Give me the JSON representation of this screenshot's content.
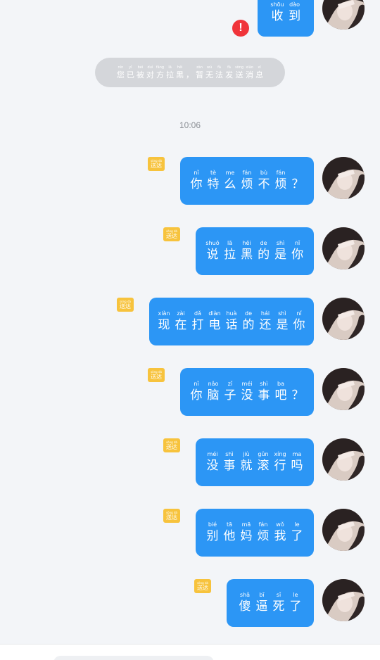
{
  "colors": {
    "bubble": "#2c96f5",
    "badge": "#f7c33d",
    "error": "#f0343a",
    "notice": "#d4d6da",
    "background": "#f3f5f8"
  },
  "icons": {
    "error": "exclamation-icon",
    "avatar": "avatar-photo"
  },
  "badge_label": {
    "pinyin": "sòng dá",
    "hanzi": "送达"
  },
  "top_message": {
    "chars": [
      {
        "py": "shōu",
        "hz": "收"
      },
      {
        "py": "dào",
        "hz": "到"
      }
    ],
    "error_mark": "!"
  },
  "notice": {
    "chars": [
      {
        "py": "nín",
        "hz": "您"
      },
      {
        "py": "yǐ",
        "hz": "已"
      },
      {
        "py": "bèi",
        "hz": "被"
      },
      {
        "py": "duì",
        "hz": "对"
      },
      {
        "py": "fāng",
        "hz": "方"
      },
      {
        "py": "lā",
        "hz": "拉"
      },
      {
        "py": "hēi",
        "hz": "黑"
      },
      {
        "py": "",
        "hz": "，"
      },
      {
        "py": "zàn",
        "hz": "暂"
      },
      {
        "py": "wú",
        "hz": "无"
      },
      {
        "py": "fǎ",
        "hz": "法"
      },
      {
        "py": "fā",
        "hz": "发"
      },
      {
        "py": "sòng",
        "hz": "送"
      },
      {
        "py": "xiāo",
        "hz": "消"
      },
      {
        "py": "xī",
        "hz": "息"
      }
    ]
  },
  "timestamp": "10:06",
  "messages": [
    {
      "chars": [
        {
          "py": "nǐ",
          "hz": "你"
        },
        {
          "py": "tè",
          "hz": "特"
        },
        {
          "py": "me",
          "hz": "么"
        },
        {
          "py": "fán",
          "hz": "烦"
        },
        {
          "py": "bù",
          "hz": "不"
        },
        {
          "py": "fán",
          "hz": "烦"
        },
        {
          "py": "",
          "hz": "？"
        }
      ]
    },
    {
      "chars": [
        {
          "py": "shuō",
          "hz": "说"
        },
        {
          "py": "lā",
          "hz": "拉"
        },
        {
          "py": "hēi",
          "hz": "黑"
        },
        {
          "py": "de",
          "hz": "的"
        },
        {
          "py": "shì",
          "hz": "是"
        },
        {
          "py": "nǐ",
          "hz": "你"
        }
      ]
    },
    {
      "chars": [
        {
          "py": "xiàn",
          "hz": "现"
        },
        {
          "py": "zài",
          "hz": "在"
        },
        {
          "py": "dǎ",
          "hz": "打"
        },
        {
          "py": "diàn",
          "hz": "电"
        },
        {
          "py": "huà",
          "hz": "话"
        },
        {
          "py": "de",
          "hz": "的"
        },
        {
          "py": "hái",
          "hz": "还"
        },
        {
          "py": "shì",
          "hz": "是"
        },
        {
          "py": "nǐ",
          "hz": "你"
        }
      ]
    },
    {
      "chars": [
        {
          "py": "nǐ",
          "hz": "你"
        },
        {
          "py": "nǎo",
          "hz": "脑"
        },
        {
          "py": "zǐ",
          "hz": "子"
        },
        {
          "py": "méi",
          "hz": "没"
        },
        {
          "py": "shì",
          "hz": "事"
        },
        {
          "py": "ba",
          "hz": "吧"
        },
        {
          "py": "",
          "hz": "？"
        }
      ]
    },
    {
      "chars": [
        {
          "py": "méi",
          "hz": "没"
        },
        {
          "py": "shì",
          "hz": "事"
        },
        {
          "py": "jiù",
          "hz": "就"
        },
        {
          "py": "gǔn",
          "hz": "滚"
        },
        {
          "py": "xíng",
          "hz": "行"
        },
        {
          "py": "ma",
          "hz": "吗"
        }
      ]
    },
    {
      "chars": [
        {
          "py": "bié",
          "hz": "别"
        },
        {
          "py": "tā",
          "hz": "他"
        },
        {
          "py": "mā",
          "hz": "妈"
        },
        {
          "py": "fán",
          "hz": "烦"
        },
        {
          "py": "wǒ",
          "hz": "我"
        },
        {
          "py": "le",
          "hz": "了"
        }
      ]
    },
    {
      "chars": [
        {
          "py": "shǎ",
          "hz": "傻"
        },
        {
          "py": "bī",
          "hz": "逼"
        },
        {
          "py": "sǐ",
          "hz": "死"
        },
        {
          "py": "le",
          "hz": "了"
        }
      ]
    }
  ]
}
